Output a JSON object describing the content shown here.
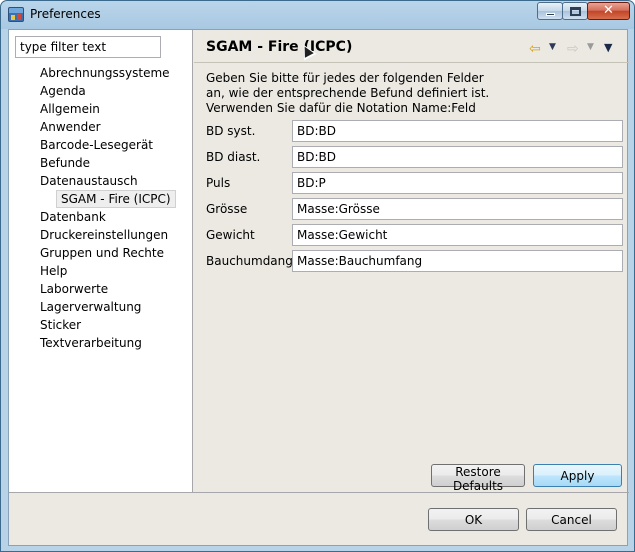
{
  "window": {
    "title": "Preferences"
  },
  "filter": {
    "placeholder": "type filter text",
    "value": "type filter text"
  },
  "tree": {
    "items": [
      "Abrechnungssysteme",
      "Agenda",
      "Allgemein",
      "Anwender",
      "Barcode-Lesegerät",
      "Befunde",
      "Datenaustausch",
      "SGAM - Fire (ICPC)",
      "Datenbank",
      "Druckereinstellungen",
      "Gruppen und Rechte",
      "Help",
      "Laborwerte",
      "Lagerverwaltung",
      "Sticker",
      "Textverarbeitung"
    ],
    "selected": "SGAM - Fire (ICPC)"
  },
  "page": {
    "title": "SGAM - Fire (ICPC)",
    "intro": [
      "Geben Sie bitte für jedes der folgenden Felder",
      "an, wie der entsprechende Befund definiert ist.",
      "Verwenden Sie dafür die Notation Name:Feld"
    ],
    "fields": [
      {
        "label": "BD syst.",
        "value": "BD:BD"
      },
      {
        "label": "BD diast.",
        "value": "BD:BD"
      },
      {
        "label": "Puls",
        "value": "BD:P"
      },
      {
        "label": "Grösse",
        "value": "Masse:Grösse"
      },
      {
        "label": "Gewicht",
        "value": "Masse:Gewicht"
      },
      {
        "label": "Bauchumdang",
        "value": "Masse:Bauchumfang"
      }
    ]
  },
  "buttons": {
    "restore": "Restore Defaults",
    "apply": "Apply",
    "ok": "OK",
    "cancel": "Cancel"
  },
  "icons": {
    "back": "arrow-left-icon",
    "forward": "arrow-right-icon",
    "menu": "view-menu-icon"
  }
}
